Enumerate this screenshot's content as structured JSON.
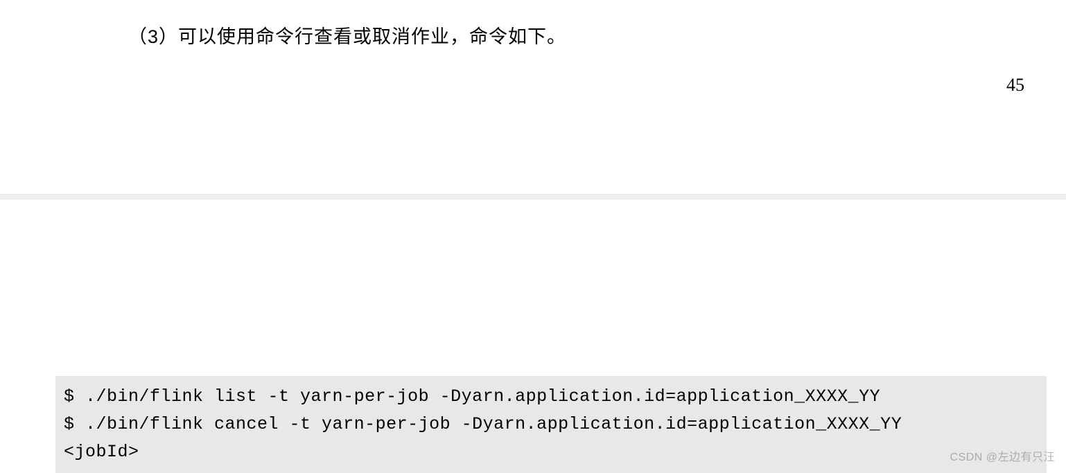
{
  "upper": {
    "paragraph": "（3）可以使用命令行查看或取消作业，命令如下。",
    "page_number": "45"
  },
  "code": {
    "line1": "$ ./bin/flink list -t yarn-per-job -Dyarn.application.id=application_XXXX_YY",
    "line2": "$ ./bin/flink cancel -t yarn-per-job -Dyarn.application.id=application_XXXX_YY",
    "line3": "<jobId>"
  },
  "watermark": "CSDN @左边有只汪"
}
